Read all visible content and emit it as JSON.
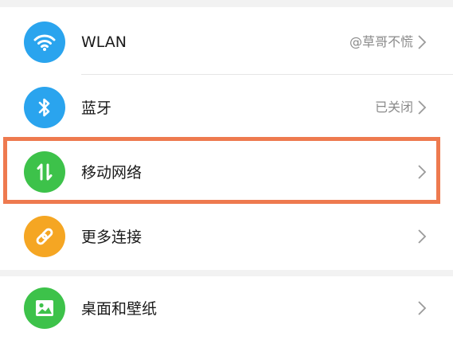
{
  "settings": {
    "items": [
      {
        "label": "WLAN",
        "value": "@草哥不慌",
        "icon": "wifi-icon",
        "icon_color": "#2aa4ee"
      },
      {
        "label": "蓝牙",
        "value": "已关闭",
        "icon": "bluetooth-icon",
        "icon_color": "#2aa4ee"
      },
      {
        "label": "移动网络",
        "value": "",
        "icon": "mobile-data-icon",
        "icon_color": "#3dc24a"
      },
      {
        "label": "更多连接",
        "value": "",
        "icon": "link-icon",
        "icon_color": "#f5a623"
      },
      {
        "label": "桌面和壁纸",
        "value": "",
        "icon": "picture-icon",
        "icon_color": "#3dc24a"
      }
    ]
  },
  "highlight": {
    "color": "#ee7a4f"
  }
}
